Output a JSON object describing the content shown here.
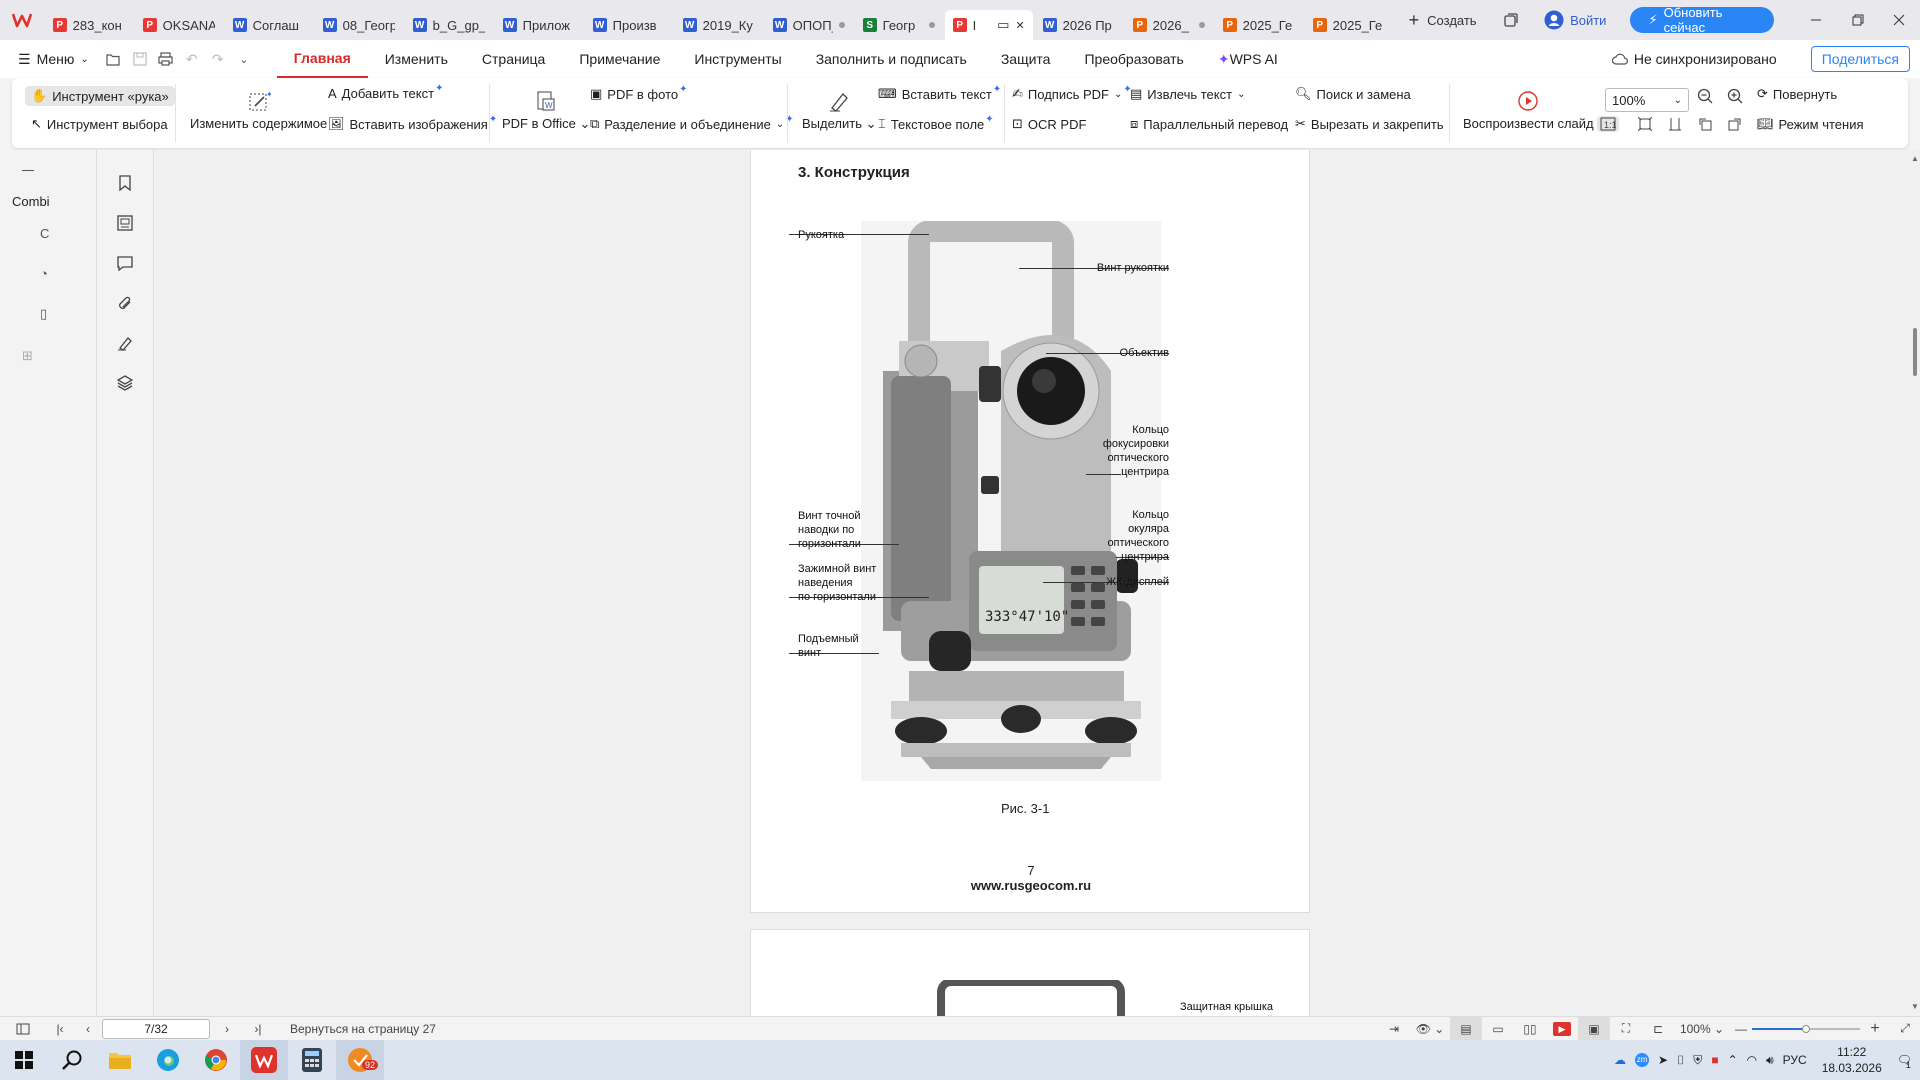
{
  "tabs": [
    {
      "label": "283_кон",
      "type": "pdf",
      "active": false,
      "dot": false
    },
    {
      "label": "OKSANA",
      "type": "pdf",
      "active": false,
      "dot": false
    },
    {
      "label": "Соглаш",
      "type": "doc",
      "active": false,
      "dot": false
    },
    {
      "label": "08_Геогр",
      "type": "doc",
      "active": false,
      "dot": false
    },
    {
      "label": "b_G_gp_",
      "type": "doc",
      "active": false,
      "dot": false
    },
    {
      "label": "Прилож",
      "type": "doc",
      "active": false,
      "dot": false
    },
    {
      "label": "Произв",
      "type": "doc",
      "active": false,
      "dot": false
    },
    {
      "label": "2019_Ку",
      "type": "doc",
      "active": false,
      "dot": false
    },
    {
      "label": "ОПОП_",
      "type": "doc",
      "active": false,
      "dot": true
    },
    {
      "label": "Геогр",
      "type": "xls",
      "active": false,
      "dot": true
    },
    {
      "label": "I",
      "type": "pdf",
      "active": true,
      "dot": false
    },
    {
      "label": "2026 Пр",
      "type": "doc",
      "active": false,
      "dot": false
    },
    {
      "label": "2026_",
      "type": "ppt",
      "active": false,
      "dot": true
    },
    {
      "label": "2025_Ге",
      "type": "ppt",
      "active": false,
      "dot": false
    },
    {
      "label": "2025_Ге",
      "type": "ppt",
      "active": false,
      "dot": false
    }
  ],
  "new_tab_label": "Создать",
  "login_label": "Войти",
  "update_label": "Обновить сейчас",
  "menu": {
    "label": "Меню",
    "items": [
      "Главная",
      "Изменить",
      "Страница",
      "Примечание",
      "Инструменты",
      "Заполнить и подписать",
      "Защита",
      "Преобразовать",
      "WPS AI"
    ],
    "active": "Главная"
  },
  "sync_label": "Не синхронизировано",
  "share_label": "Поделиться",
  "ribbon": {
    "hand": "Инструмент «рука»",
    "select": "Инструмент выбора",
    "edit_content": "Изменить содержимое",
    "add_text": "Добавить текст",
    "insert_images": "Вставить изображения",
    "pdf_to_office": "PDF в Office",
    "pdf_to_photo": "PDF в фото",
    "split_merge": "Разделение и объединение",
    "highlight": "Выделить",
    "insert_text": "Вставить текст",
    "text_field": "Текстовое поле",
    "sign_pdf": "Подпись PDF",
    "ocr_pdf": "OCR PDF",
    "extract_text": "Извлечь текст",
    "parallel_translate": "Параллельный перевод",
    "search_replace": "Поиск и замена",
    "cut_pin": "Вырезать и закрепить",
    "play_slide": "Воспроизвести слайд",
    "zoom": "100%",
    "rotate": "Повернуть",
    "reading_mode": "Режим чтения"
  },
  "left_pane": {
    "label": "Combi"
  },
  "document": {
    "section_title": "3. Конструкция",
    "labels_left": [
      "Рукоятка",
      "Винт точной\nнаводки по\nгоризонтали",
      "Зажимной винт\nнаведения\nпо горизонтали",
      "Подъемный\nвинт"
    ],
    "labels_right": [
      "Винт рукоятки",
      "Объектив",
      "Кольцо\nфокусировки\nоптического\nцентрира",
      "Кольцо\nокуляра\nоптического\nцентрира",
      "ЖК-дисплей"
    ],
    "lcd_readout": "333°47'10\"",
    "caption": "Рис. 3-1",
    "page_number": "7",
    "site": "www.rusgeocom.ru",
    "next_page_label": "Защитная крышка\nвизирных нитей"
  },
  "status": {
    "page": "7/32",
    "back_label": "Вернуться на страницу 27",
    "zoom": "100%"
  },
  "taskbar": {
    "time": "11:22",
    "date": "18.03.2026",
    "lang": "РУС",
    "badge": "92",
    "notif": "1"
  }
}
